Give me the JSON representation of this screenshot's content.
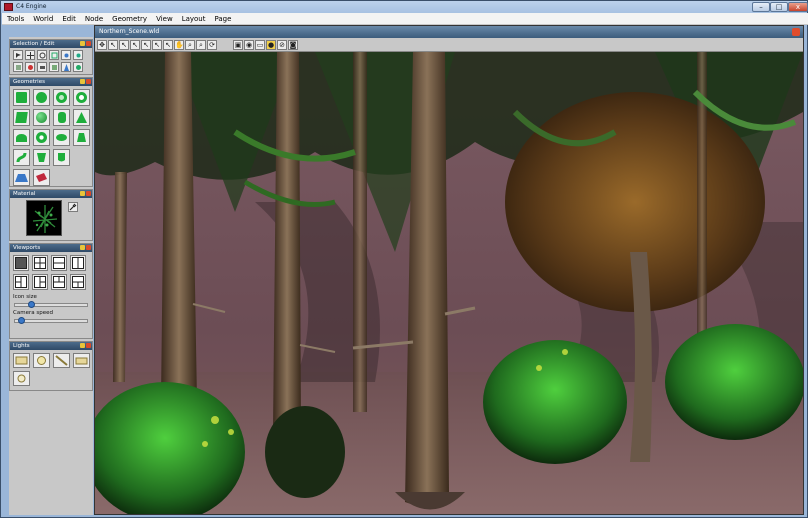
{
  "window": {
    "title": "C4 Engine",
    "buttons": {
      "minimize": "–",
      "maximize": "□",
      "close": "x"
    }
  },
  "menu": [
    "Tools",
    "World",
    "Edit",
    "Node",
    "Geometry",
    "View",
    "Layout",
    "Page"
  ],
  "panels": {
    "selection": {
      "title": "Selection / Edit"
    },
    "geometries": {
      "title": "Geometries"
    },
    "material": {
      "title": "Material"
    },
    "viewports": {
      "title": "Viewports",
      "icon_size_label": "Icon size",
      "camera_speed_label": "Camera speed",
      "icon_size_value": 0.2,
      "camera_speed_value": 0.05
    },
    "lights": {
      "title": "Lights"
    }
  },
  "viewport": {
    "title": "Northern_Scene.wld"
  },
  "colors": {
    "accent": "#3a78c8",
    "geometry_green": "#1fae3c",
    "ground": "#7a5a5c"
  }
}
